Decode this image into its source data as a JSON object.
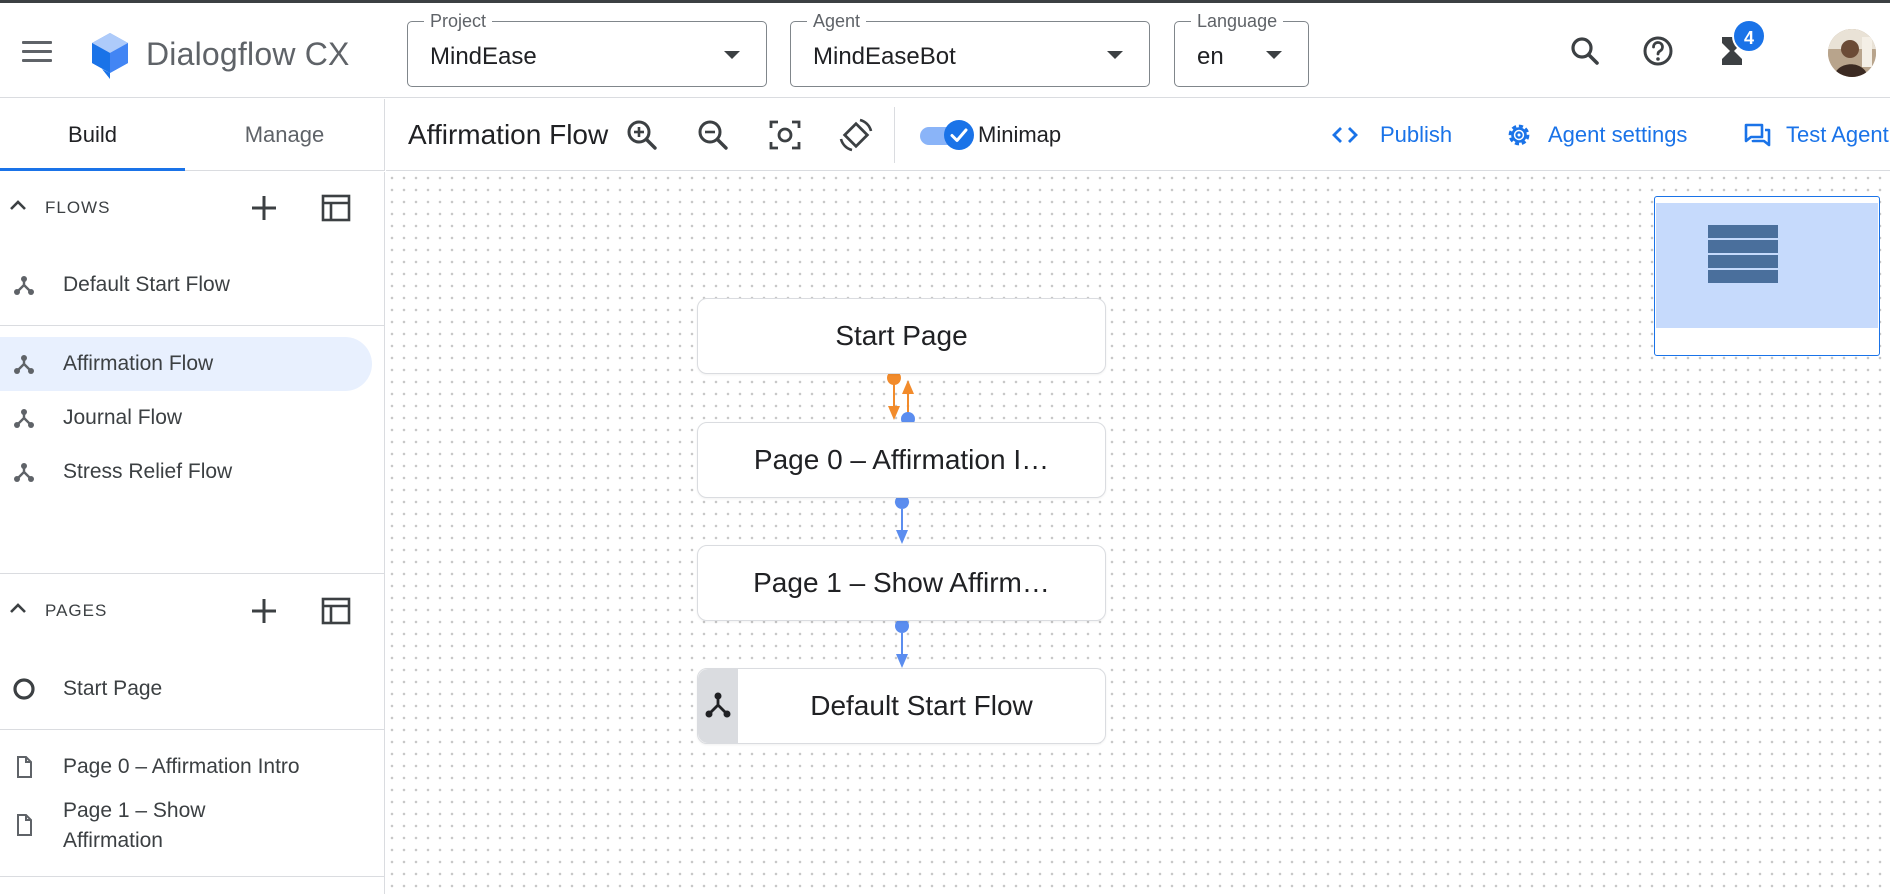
{
  "header": {
    "brand": "Dialogflow CX",
    "project": {
      "label": "Project",
      "value": "MindEase"
    },
    "agent": {
      "label": "Agent",
      "value": "MindEaseBot"
    },
    "language": {
      "label": "Language",
      "value": "en"
    },
    "notification_count": "4"
  },
  "tabs": {
    "build": "Build",
    "manage": "Manage"
  },
  "toolbar": {
    "flow_title": "Affirmation Flow",
    "minimap_label": "Minimap",
    "minimap_enabled": true,
    "publish": "Publish",
    "agent_settings": "Agent settings",
    "test_agent": "Test Agent"
  },
  "sidebar": {
    "flows_title": "FLOWS",
    "flows": [
      {
        "label": "Default Start Flow"
      },
      {
        "label": "Affirmation Flow",
        "selected": true
      },
      {
        "label": "Journal Flow"
      },
      {
        "label": "Stress Relief Flow"
      }
    ],
    "pages_title": "PAGES",
    "pages": [
      {
        "label": "Start Page"
      },
      {
        "label": "Page 0 – Affirmation Intro"
      },
      {
        "label": "Page 1 – Show Affirmation"
      }
    ]
  },
  "canvas": {
    "nodes": [
      {
        "label": "Start Page"
      },
      {
        "label": "Page 0 – Affirmation I…"
      },
      {
        "label": "Page 1 – Show Affirm…"
      },
      {
        "label": "Default Start Flow"
      }
    ]
  },
  "colors": {
    "accent": "#1a73e8",
    "edge": "#5b8def",
    "route_edge": "#f28b2b",
    "selected_bg": "#e8f0fe"
  }
}
